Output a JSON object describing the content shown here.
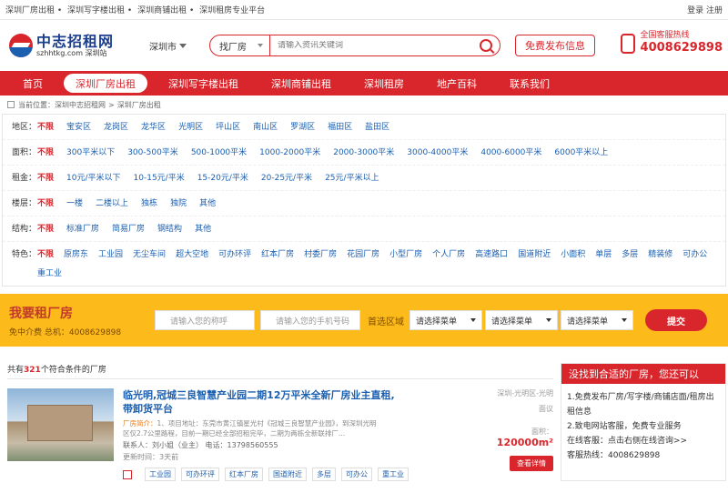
{
  "topbar": {
    "links": [
      "深圳厂房出租",
      "深圳写字楼出租",
      "深圳商铺出租",
      "深圳租房专业平台"
    ],
    "login": "登录",
    "register": "注册"
  },
  "header": {
    "logo_title": "中志招租网",
    "logo_sub": "szhhtkg.com  深圳站",
    "city": "深圳市",
    "search_type": "找厂房",
    "search_placeholder": "请输入资讯关键词",
    "publish": "免费发布信息",
    "hotline_label": "全国客服热线",
    "hotline_number": "4008629898"
  },
  "nav": [
    "首页",
    "深圳厂房出租",
    "深圳写字楼出租",
    "深圳商铺出租",
    "深圳租房",
    "地产百科",
    "联系我们"
  ],
  "breadcrumb": {
    "prefix": "当前位置：",
    "items": [
      "深圳中志招租网",
      "深圳厂房出租"
    ],
    "sep": ">"
  },
  "filters": [
    {
      "key": "地区：",
      "options": [
        "不限",
        "宝安区",
        "龙岗区",
        "龙华区",
        "光明区",
        "坪山区",
        "南山区",
        "罗湖区",
        "福田区",
        "盐田区"
      ]
    },
    {
      "key": "面积：",
      "options": [
        "不限",
        "300平米以下",
        "300-500平米",
        "500-1000平米",
        "1000-2000平米",
        "2000-3000平米",
        "3000-4000平米",
        "4000-6000平米",
        "6000平米以上"
      ]
    },
    {
      "key": "租金：",
      "options": [
        "不限",
        "10元/平米以下",
        "10-15元/平米",
        "15-20元/平米",
        "20-25元/平米",
        "25元/平米以上"
      ]
    },
    {
      "key": "楼层：",
      "options": [
        "不限",
        "一楼",
        "二楼以上",
        "独栋",
        "独院",
        "其他"
      ]
    },
    {
      "key": "结构：",
      "options": [
        "不限",
        "标准厂房",
        "简易厂房",
        "钢结构",
        "其他"
      ]
    },
    {
      "key": "特色：",
      "options": [
        "不限",
        "原房东",
        "工业园",
        "无尘车间",
        "超大空地",
        "可办环评",
        "红本厂房",
        "村委厂房",
        "花园厂房",
        "小型厂房",
        "个人厂房",
        "高速路口",
        "国道附近",
        "小面积",
        "单层",
        "多层",
        "精装修",
        "可办公",
        "重工业"
      ]
    }
  ],
  "want": {
    "title": "我要租厂房",
    "subtitle": "免中介费 总机：4008629898",
    "name_placeholder": "请输入您的称呼",
    "phone_placeholder": "请输入您的手机号码",
    "area_label": "首选区域",
    "dropdowns": [
      "请选择菜单",
      "请选择菜单",
      "请选择菜单"
    ],
    "submit": "提交"
  },
  "results": {
    "prefix": "共有",
    "count": "321",
    "suffix": "个符合条件的厂房"
  },
  "listing": {
    "title": "临光明,冠城三良智慧产业园二期12万平米全新厂房业主直租,带卸货平台",
    "desc_tag": "厂房简介：",
    "desc": "1、项目地址：东莞市黄江镇星光村《冠城三良智慧产业园》，到深圳光明区仅2.7公里路程，目前一期已经全部招租完毕，二期为两栋全新联排厂...",
    "contact": "联系人：刘小姐（业主） 电话：13798560555",
    "updated": "更新时间：3天前",
    "tags": [
      "工业园",
      "可办环评",
      "红本厂房",
      "国道附近",
      "多层",
      "可办公",
      "重工业"
    ],
    "location": "深圳-光明区-光明",
    "size_label": "面议",
    "area_prefix": "面积：",
    "area_value": "120000m²",
    "detail_button": "查看详情"
  },
  "sidebar": {
    "title": "没找到合适的厂房，您还可以",
    "lines": [
      "1.免费发布厂房/写字楼/商铺店面/租房出租信息",
      "2.致电网站客服，免费专业服务",
      "在线客服：点击右侧在线咨询>>",
      "客服热线：4008629898"
    ]
  }
}
